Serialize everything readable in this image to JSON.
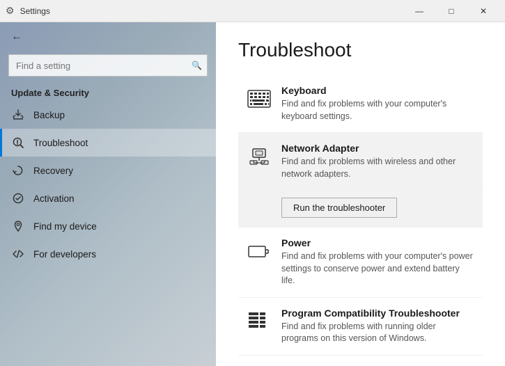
{
  "titleBar": {
    "title": "Settings",
    "minimize": "—",
    "maximize": "□",
    "close": "✕"
  },
  "sidebar": {
    "backLabel": "Settings",
    "search": {
      "placeholder": "Find a setting",
      "value": ""
    },
    "sectionLabel": "Update & Security",
    "navItems": [
      {
        "id": "backup",
        "label": "Backup",
        "icon": "backup"
      },
      {
        "id": "troubleshoot",
        "label": "Troubleshoot",
        "icon": "troubleshoot",
        "active": true
      },
      {
        "id": "recovery",
        "label": "Recovery",
        "icon": "recovery"
      },
      {
        "id": "activation",
        "label": "Activation",
        "icon": "activation"
      },
      {
        "id": "find-my-device",
        "label": "Find my device",
        "icon": "find-device"
      },
      {
        "id": "for-developers",
        "label": "For developers",
        "icon": "developers"
      }
    ]
  },
  "content": {
    "pageTitle": "Troubleshoot",
    "items": [
      {
        "id": "keyboard",
        "name": "Keyboard",
        "description": "Find and fix problems with your computer's keyboard settings.",
        "highlighted": false
      },
      {
        "id": "network-adapter",
        "name": "Network Adapter",
        "description": "Find and fix problems with wireless and other network adapters.",
        "highlighted": true,
        "runButton": "Run the troubleshooter"
      },
      {
        "id": "power",
        "name": "Power",
        "description": "Find and fix problems with your computer's power settings to conserve power and extend battery life.",
        "highlighted": false
      },
      {
        "id": "program-compat",
        "name": "Program Compatibility Troubleshooter",
        "description": "Find and fix problems with running older programs on this version of Windows.",
        "highlighted": false
      }
    ]
  }
}
